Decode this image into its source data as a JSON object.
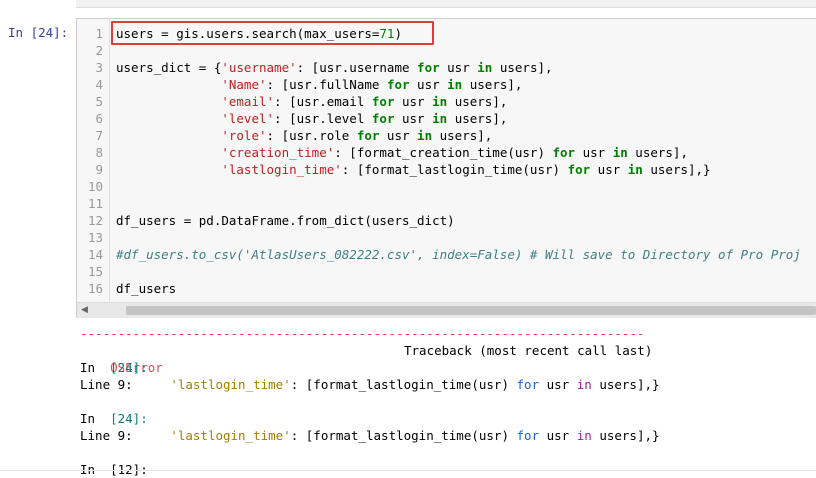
{
  "cell": {
    "prompt": "In [24]:",
    "lines": [
      {
        "n": "1",
        "segments": [
          {
            "t": "users = gis.users.search(max_users=",
            "c": ""
          },
          {
            "t": "71",
            "c": "num"
          },
          {
            "t": ")",
            "c": ""
          }
        ]
      },
      {
        "n": "2",
        "segments": []
      },
      {
        "n": "3",
        "segments": [
          {
            "t": "users_dict = {",
            "c": ""
          },
          {
            "t": "'username'",
            "c": "str"
          },
          {
            "t": ": [usr.username ",
            "c": ""
          },
          {
            "t": "for",
            "c": "kw"
          },
          {
            "t": " usr ",
            "c": ""
          },
          {
            "t": "in",
            "c": "kw"
          },
          {
            "t": " users],",
            "c": ""
          }
        ]
      },
      {
        "n": "4",
        "segments": [
          {
            "t": "              ",
            "c": ""
          },
          {
            "t": "'Name'",
            "c": "str"
          },
          {
            "t": ": [usr.fullName ",
            "c": ""
          },
          {
            "t": "for",
            "c": "kw"
          },
          {
            "t": " usr ",
            "c": ""
          },
          {
            "t": "in",
            "c": "kw"
          },
          {
            "t": " users],",
            "c": ""
          }
        ]
      },
      {
        "n": "5",
        "segments": [
          {
            "t": "              ",
            "c": ""
          },
          {
            "t": "'email'",
            "c": "str"
          },
          {
            "t": ": [usr.email ",
            "c": ""
          },
          {
            "t": "for",
            "c": "kw"
          },
          {
            "t": " usr ",
            "c": ""
          },
          {
            "t": "in",
            "c": "kw"
          },
          {
            "t": " users],",
            "c": ""
          }
        ]
      },
      {
        "n": "6",
        "segments": [
          {
            "t": "              ",
            "c": ""
          },
          {
            "t": "'level'",
            "c": "str"
          },
          {
            "t": ": [usr.level ",
            "c": ""
          },
          {
            "t": "for",
            "c": "kw"
          },
          {
            "t": " usr ",
            "c": ""
          },
          {
            "t": "in",
            "c": "kw"
          },
          {
            "t": " users],",
            "c": ""
          }
        ]
      },
      {
        "n": "7",
        "segments": [
          {
            "t": "              ",
            "c": ""
          },
          {
            "t": "'role'",
            "c": "str"
          },
          {
            "t": ": [usr.role ",
            "c": ""
          },
          {
            "t": "for",
            "c": "kw"
          },
          {
            "t": " usr ",
            "c": ""
          },
          {
            "t": "in",
            "c": "kw"
          },
          {
            "t": " users],",
            "c": ""
          }
        ]
      },
      {
        "n": "8",
        "segments": [
          {
            "t": "              ",
            "c": ""
          },
          {
            "t": "'creation_time'",
            "c": "str"
          },
          {
            "t": ": [format_creation_time(usr) ",
            "c": ""
          },
          {
            "t": "for",
            "c": "kw"
          },
          {
            "t": " usr ",
            "c": ""
          },
          {
            "t": "in",
            "c": "kw"
          },
          {
            "t": " users],",
            "c": ""
          }
        ]
      },
      {
        "n": "9",
        "segments": [
          {
            "t": "              ",
            "c": ""
          },
          {
            "t": "'lastlogin_time'",
            "c": "str"
          },
          {
            "t": ": [format_lastlogin_time(usr) ",
            "c": ""
          },
          {
            "t": "for",
            "c": "kw"
          },
          {
            "t": " usr ",
            "c": ""
          },
          {
            "t": "in",
            "c": "kw"
          },
          {
            "t": " users],}",
            "c": ""
          }
        ]
      },
      {
        "n": "10",
        "segments": []
      },
      {
        "n": "11",
        "segments": []
      },
      {
        "n": "12",
        "segments": [
          {
            "t": "df_users = pd.DataFrame.from_dict(users_dict)",
            "c": ""
          }
        ]
      },
      {
        "n": "13",
        "segments": []
      },
      {
        "n": "14",
        "segments": [
          {
            "t": "#df_users.to_csv('AtlasUsers_082222.csv', index=False) # Will save to Directory of Pro Proj",
            "c": "cmt"
          }
        ]
      },
      {
        "n": "15",
        "segments": []
      },
      {
        "n": "16",
        "segments": [
          {
            "t": "df_users",
            "c": ""
          }
        ]
      }
    ]
  },
  "output": {
    "dashes": "---------------------------------------------------------------------------",
    "error_name": "OSError",
    "traceback_label": "Traceback (most recent call last)",
    "frames": [
      {
        "in_label": "In  ",
        "in_num": "[24]:",
        "line_label": "Line 9:     ",
        "code": [
          {
            "t": "'lastlogin_time'",
            "c": "strlit"
          },
          {
            "t": ": [format_lastlogin_time(usr) ",
            "c": ""
          },
          {
            "t": "for",
            "c": "kw2"
          },
          {
            "t": " usr ",
            "c": ""
          },
          {
            "t": "in",
            "c": "in-kw"
          },
          {
            "t": " users],}",
            "c": ""
          }
        ]
      },
      {
        "in_label": "In  ",
        "in_num": "[24]:",
        "line_label": "Line 9:     ",
        "code": [
          {
            "t": "'lastlogin_time'",
            "c": "strlit"
          },
          {
            "t": ": [format_lastlogin_time(usr) ",
            "c": ""
          },
          {
            "t": "for",
            "c": "kw2"
          },
          {
            "t": " usr ",
            "c": ""
          },
          {
            "t": "in",
            "c": "in-kw"
          },
          {
            "t": " users],}",
            "c": ""
          }
        ]
      }
    ],
    "trailing_in": "In  [12]:"
  },
  "colors": {
    "highlight_box": "#e03c3c",
    "prompt": "#303f9f",
    "keyword": "#008000",
    "string": "#ba2121"
  }
}
